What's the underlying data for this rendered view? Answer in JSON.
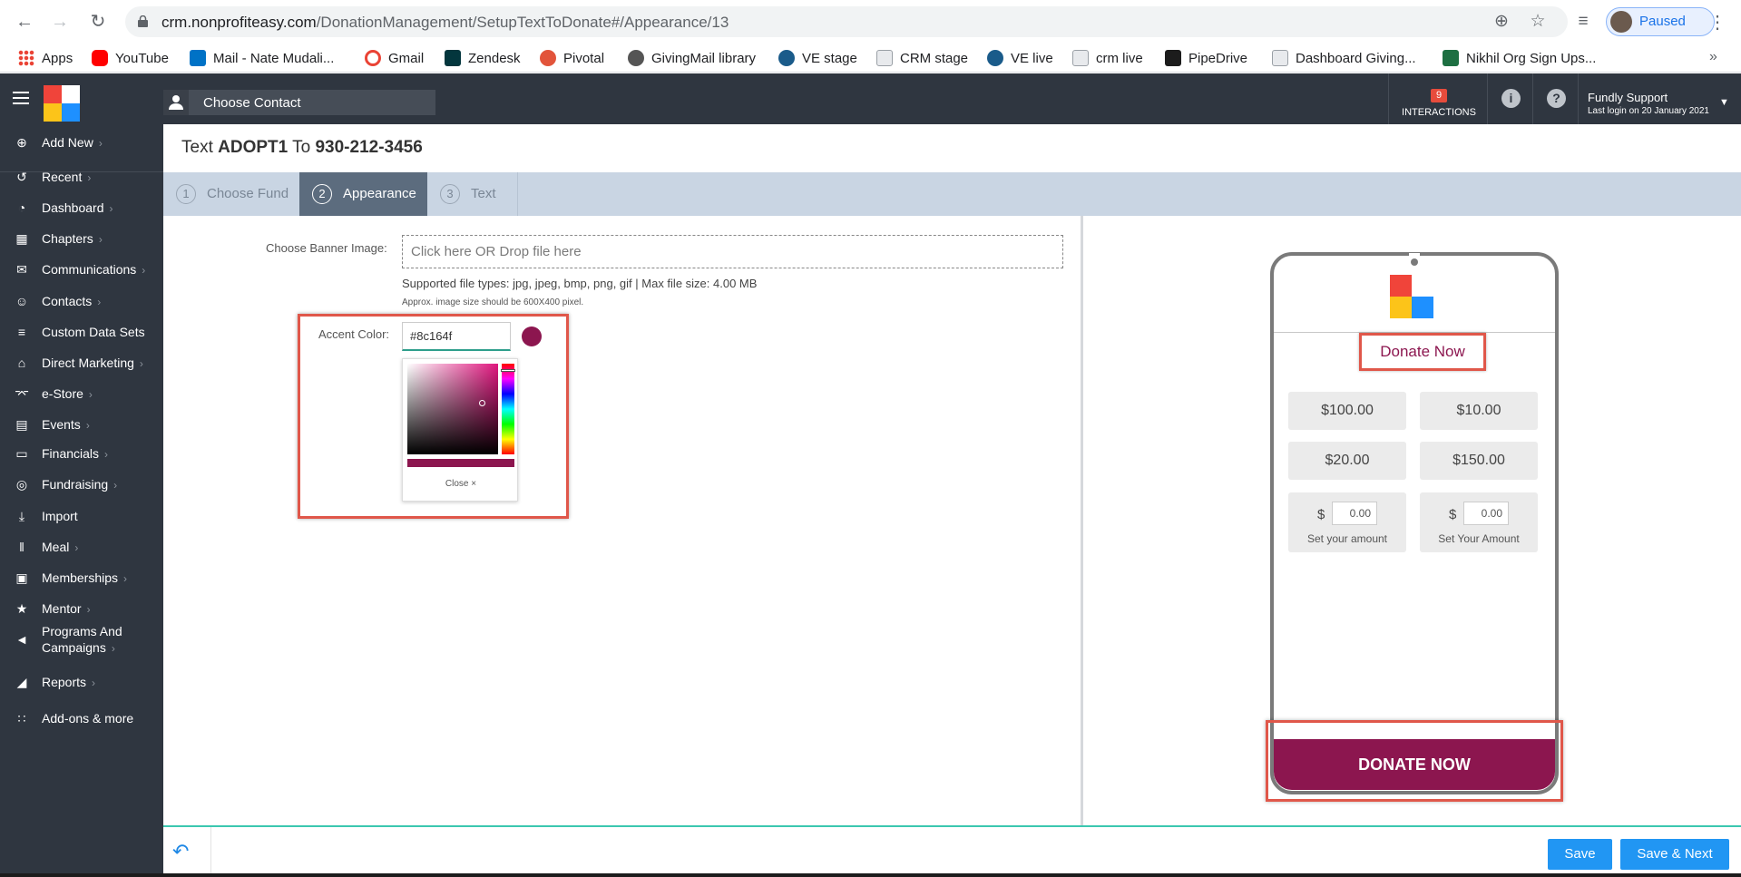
{
  "browser": {
    "url_host": "crm.nonprofiteasy.com",
    "url_path": "/DonationManagement/SetupTextToDonate#/Appearance/13",
    "profile_label": "Paused",
    "bookmarks": [
      {
        "label": "Apps",
        "color": "#4285f4"
      },
      {
        "label": "YouTube",
        "color": "#ff0000"
      },
      {
        "label": "Mail - Nate Mudali...",
        "color": "#0072c6"
      },
      {
        "label": "Gmail",
        "color": "#ea4335"
      },
      {
        "label": "Zendesk",
        "color": "#03363d"
      },
      {
        "label": "Pivotal",
        "color": "#e2543b"
      },
      {
        "label": "GivingMail library",
        "color": "#555555"
      },
      {
        "label": "VE stage",
        "color": "#1a5b8a"
      },
      {
        "label": "CRM stage",
        "color": "#9aa0a6"
      },
      {
        "label": "VE live",
        "color": "#1a5b8a"
      },
      {
        "label": "crm live",
        "color": "#9aa0a6"
      },
      {
        "label": "PipeDrive",
        "color": "#1c1c1c"
      },
      {
        "label": "Dashboard Giving...",
        "color": "#9aa0a6"
      },
      {
        "label": "Nikhil Org Sign Ups...",
        "color": "#1d6f42"
      }
    ]
  },
  "header": {
    "choose_contact": "Choose Contact",
    "interactions_count": "9",
    "interactions_label": "INTERACTIONS",
    "user_name": "Fundly Support",
    "last_login": "Last login on 20 January 2021"
  },
  "sidebar": {
    "items": [
      {
        "label": "Add New",
        "icon": "plus-circle-icon",
        "chevron": true
      },
      {
        "label": "Recent",
        "icon": "history-icon",
        "chevron": true
      },
      {
        "label": "Dashboard",
        "icon": "dashboard-icon",
        "chevron": true
      },
      {
        "label": "Chapters",
        "icon": "grid-icon",
        "chevron": true
      },
      {
        "label": "Communications",
        "icon": "envelope-icon",
        "chevron": true
      },
      {
        "label": "Contacts",
        "icon": "user-icon",
        "chevron": true
      },
      {
        "label": "Custom Data Sets",
        "icon": "layers-icon",
        "chevron": false
      },
      {
        "label": "Direct Marketing",
        "icon": "bank-icon",
        "chevron": true
      },
      {
        "label": "e-Store",
        "icon": "cart-icon",
        "chevron": true
      },
      {
        "label": "Events",
        "icon": "calendar-icon",
        "chevron": true
      },
      {
        "label": "Financials",
        "icon": "money-icon",
        "chevron": true
      },
      {
        "label": "Fundraising",
        "icon": "medal-icon",
        "chevron": true
      },
      {
        "label": "Import",
        "icon": "import-icon",
        "chevron": false
      },
      {
        "label": "Meal",
        "icon": "cutlery-icon",
        "chevron": true
      },
      {
        "label": "Memberships",
        "icon": "id-card-icon",
        "chevron": true
      },
      {
        "label": "Mentor",
        "icon": "mentor-icon",
        "chevron": true
      },
      {
        "label": "Programs And",
        "label2": "Campaigns",
        "icon": "megaphone-icon",
        "chevron": true
      },
      {
        "label": "Reports",
        "icon": "chart-icon",
        "chevron": true
      },
      {
        "label": "Add-ons & more",
        "icon": "apps-icon",
        "chevron": false
      }
    ]
  },
  "page": {
    "title_prefix": "Text ",
    "title_keyword": "ADOPT1",
    "title_mid": " To ",
    "title_number": "930-212-3456",
    "steps": [
      {
        "num": "1",
        "label": "Choose Fund",
        "active": false
      },
      {
        "num": "2",
        "label": "Appearance",
        "active": true
      },
      {
        "num": "3",
        "label": "Text",
        "active": false
      }
    ]
  },
  "form": {
    "banner_label": "Choose Banner Image:",
    "dropzone_text": "Click here OR Drop file here",
    "file_types": "Supported file types: jpg, jpeg, bmp, png, gif | Max file size: 4.00 MB",
    "approx_size": "Approx. image size should be 600X400 pixel.",
    "accent_label": "Accent Color:",
    "accent_value": "#8c164f",
    "picker_close": "Close"
  },
  "preview": {
    "accent": "#8c164f",
    "donate_link": "Donate Now",
    "amounts": [
      "$100.00",
      "$10.00",
      "$20.00",
      "$150.00"
    ],
    "custom_amounts": [
      {
        "symbol": "$",
        "value": "0.00",
        "caption": "Set your amount"
      },
      {
        "symbol": "$",
        "value": "0.00",
        "caption": "Set Your Amount"
      }
    ],
    "donate_button": "DONATE NOW"
  },
  "footer": {
    "save": "Save",
    "save_next": "Save & Next"
  }
}
